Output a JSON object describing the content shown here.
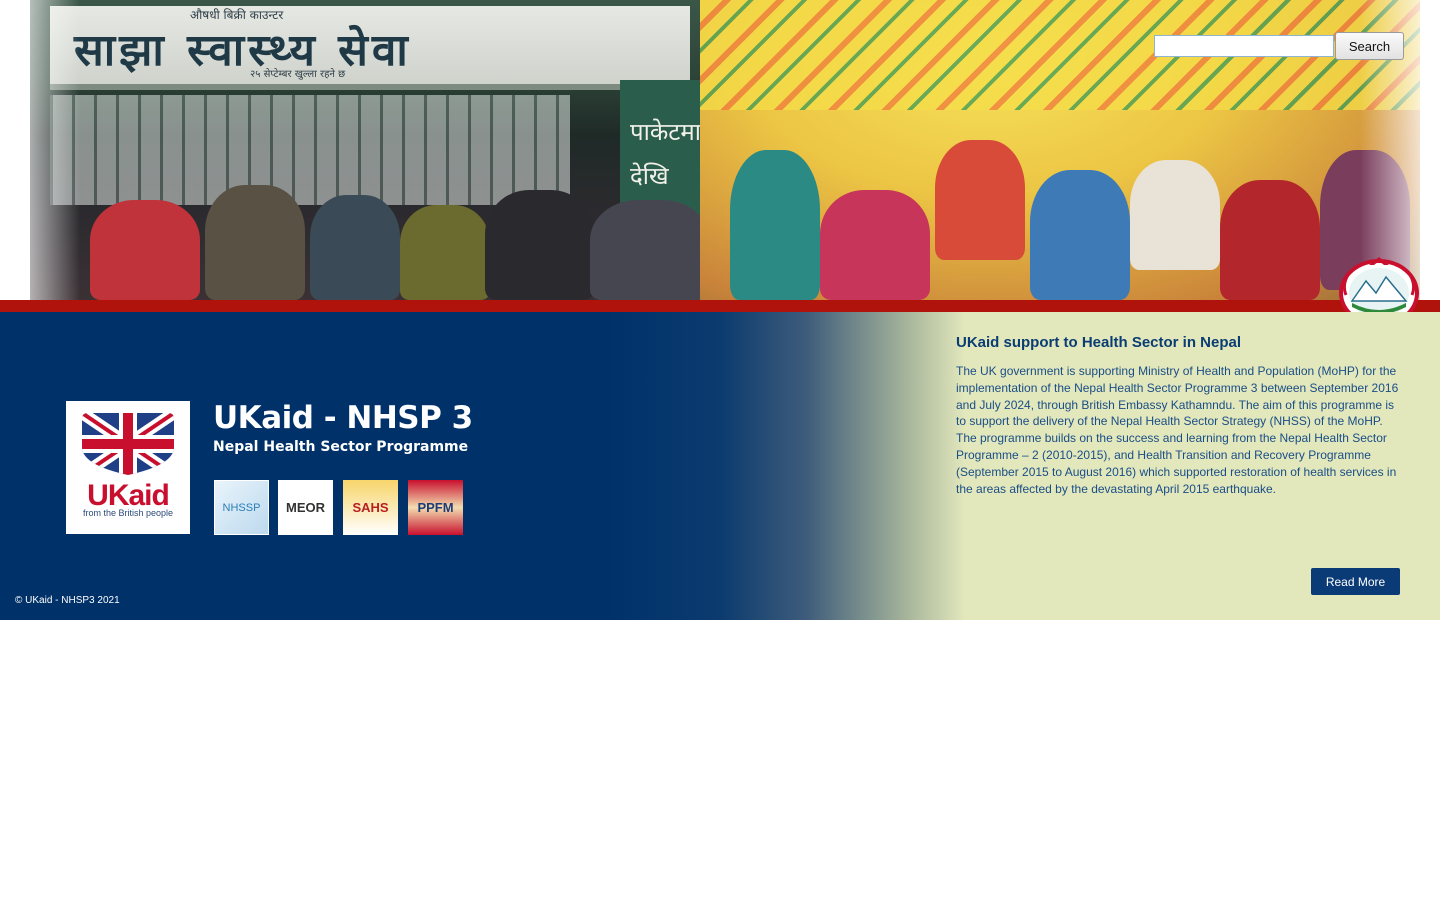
{
  "header": {
    "sign_main": "साझा स्वास्थ्य सेवा",
    "sign_top": "औषधी बिक्री काउन्टर",
    "sign_sub": "२५ सेप्टेम्बर खुल्ला रहने छ",
    "side_sign": "पाकेटमार देखि"
  },
  "search": {
    "placeholder": "",
    "button_label": "Search"
  },
  "logo": {
    "ukaid_text": "UKaid",
    "ukaid_sub": "from the British people",
    "title": "UKaid - NHSP 3",
    "subtitle": "Nepal Health Sector Programme",
    "partners": [
      "NHSSP",
      "MEOR",
      "SAHS",
      "PPFM"
    ]
  },
  "info": {
    "title": "UKaid support to Health Sector in Nepal",
    "body": "The UK government is supporting Ministry of Health and Population (MoHP) for the implementation of the Nepal Health Sector Programme 3 between September 2016 and July 2024, through British Embassy Kathamndu. The aim of this programme is to support the delivery of the Nepal Health Sector Strategy (NHSS) of the MoHP. The programme builds on the success and learning from the Nepal Health Sector Programme – 2 (2010-2015), and Health Transition and Recovery Programme (September 2015 to August 2016) which supported restoration of health services in the areas affected by the devastating April 2015 earthquake.",
    "read_more_label": "Read More"
  },
  "footer": {
    "copyright": "© UKaid - NHSP3 2021"
  },
  "colors": {
    "navy": "#003169",
    "panel": "#e2e7bc",
    "redbar": "#b0130c",
    "title_blue": "#0a3d73"
  }
}
